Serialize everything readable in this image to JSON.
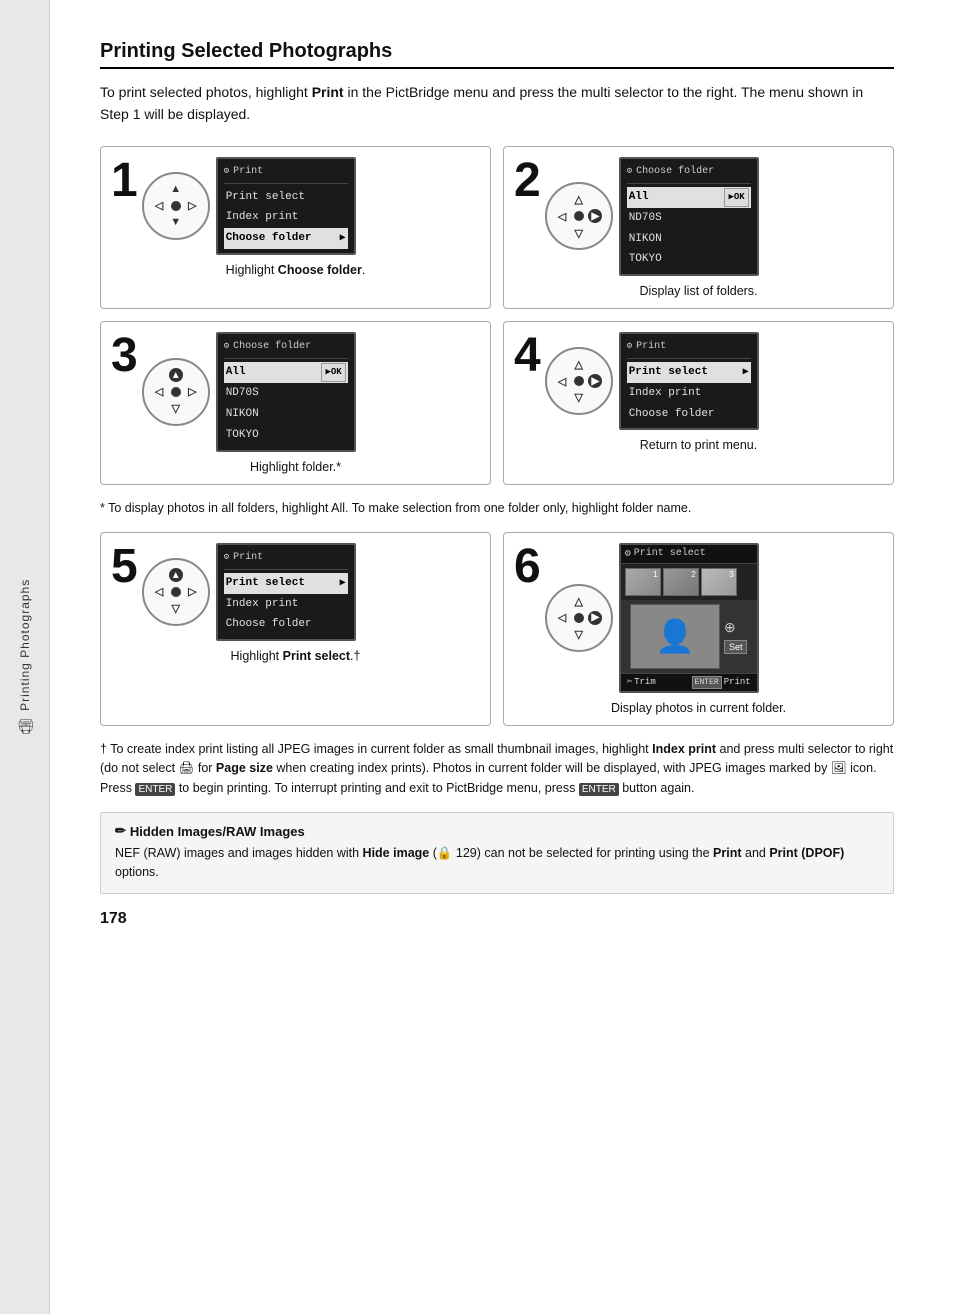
{
  "sidebar": {
    "icon": "🖨",
    "label": "Printing Photographs"
  },
  "title": "Printing Selected Photographs",
  "intro": "To print selected photos, highlight Print in the PictBridge menu and press the multi selector to the right.  The menu shown in Step 1 will be displayed.",
  "steps": [
    {
      "number": "1",
      "lcd": {
        "title": "Print",
        "rows": [
          "Print select",
          "Index print",
          "Choose folder"
        ],
        "highlighted_index": 2,
        "has_arrow": true
      },
      "caption": "Highlight Choose folder."
    },
    {
      "number": "2",
      "lcd": {
        "title": "Choose folder",
        "rows": [
          "All",
          "ND70S",
          "NIKON",
          "TOKYO"
        ],
        "highlighted_index": 0,
        "has_ok": true
      },
      "caption": "Display list of folders."
    },
    {
      "number": "3",
      "lcd": {
        "title": "Choose folder",
        "rows": [
          "All",
          "ND70S",
          "NIKON",
          "TOKYO"
        ],
        "highlighted_index": 0,
        "has_ok": true
      },
      "caption": "Highlight folder.*"
    },
    {
      "number": "4",
      "lcd": {
        "title": "Print",
        "rows": [
          "Print select",
          "Index print",
          "Choose folder"
        ],
        "highlighted_index": 0,
        "has_arrow": true
      },
      "caption": "Return to print menu."
    },
    {
      "number": "5",
      "lcd": {
        "title": "Print",
        "rows": [
          "Print select",
          "Index print",
          "Choose folder"
        ],
        "highlighted_index": 0,
        "has_arrow": true
      },
      "caption": "Highlight Print select.†"
    },
    {
      "number": "6",
      "type": "photo",
      "caption": "Display photos in current folder."
    }
  ],
  "footnote_star": "* To display photos in all folders, highlight All.  To make selection from one folder only, highlight folder name.",
  "footnote_dagger": "† To create index print listing all JPEG images in current folder as small thumbnail images, highlight Index print and press multi selector to right (do not select  for Page size when creating index prints).  Photos in current folder will be displayed, with JPEG images marked by  icon.  Press  to begin printing.  To interrupt printing and exit to PictBridge menu, press  button again.",
  "note": {
    "title": "Hidden Images/RAW Images",
    "text": "NEF (RAW) images and images hidden with Hide image ( 129) can not be selected for printing using the Print and Print (DPOF) options."
  },
  "page_number": "178",
  "labels": {
    "choose_folder": "Choose folder",
    "print_select": "Print select",
    "index_print": "Index print",
    "all": "All",
    "nd70s": "ND70S",
    "nikon": "NIKON",
    "tokyo": "TOKYO",
    "print": "Print",
    "set": "Set",
    "trim": "Trim",
    "enter_print": "Print"
  }
}
